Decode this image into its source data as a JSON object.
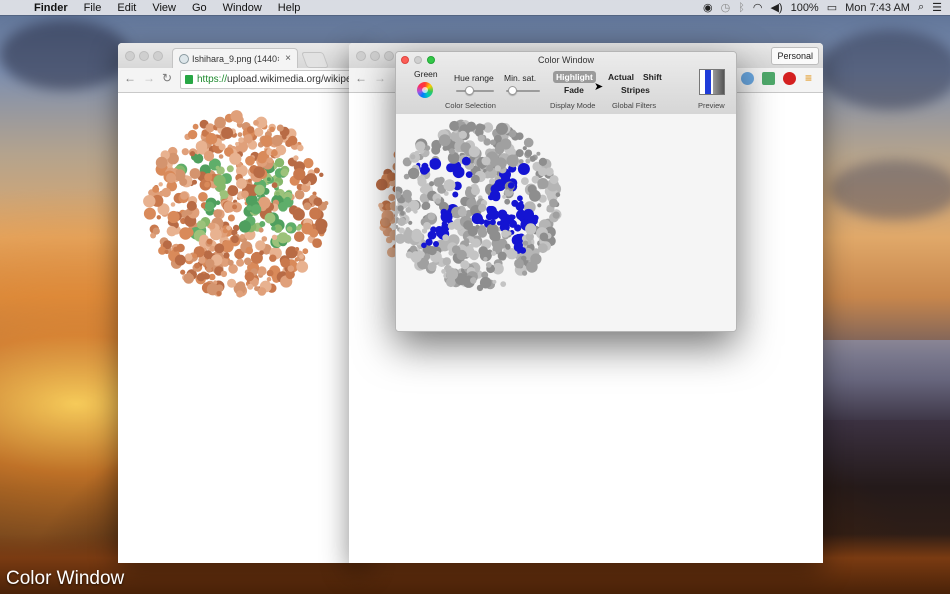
{
  "menubar": {
    "app": "Finder",
    "items": [
      "File",
      "Edit",
      "View",
      "Go",
      "Window",
      "Help"
    ],
    "battery": "100%",
    "clock": "Mon 7:43 AM",
    "icons": [
      "eye-icon",
      "time-machine-icon",
      "bluetooth-icon",
      "wifi-icon",
      "volume-icon",
      "battery-icon",
      "spotlight-icon",
      "notification-center-icon"
    ]
  },
  "browser_left": {
    "tab_title": "Ishihara_9.png (1440×1440",
    "tab_close": "×",
    "url_https": "https://",
    "url_rest": "upload.wikimedia.org/wikipe"
  },
  "browser_right": {
    "personal": "Personal"
  },
  "color_window": {
    "title": "Color Window",
    "color_name": "Green",
    "hue_range_label": "Hue range",
    "min_sat_label": "Min. sat.",
    "hue_range_value": 0.4,
    "min_sat_value": 0.2,
    "highlight_label": "Highlight",
    "fade_label": "Fade",
    "actual_label": "Actual",
    "shift_label": "Shift",
    "stripes_label": "Stripes",
    "group_color_selection": "Color Selection",
    "group_display_mode": "Display Mode",
    "group_global_filters": "Global Filters",
    "preview_label": "Preview"
  },
  "caption": "Color Window",
  "colors": {
    "highlight": "#1414d2",
    "plate_orange": "#d98a5a",
    "plate_green": "#4faa66",
    "plate_gray": "#9a9a9a"
  }
}
